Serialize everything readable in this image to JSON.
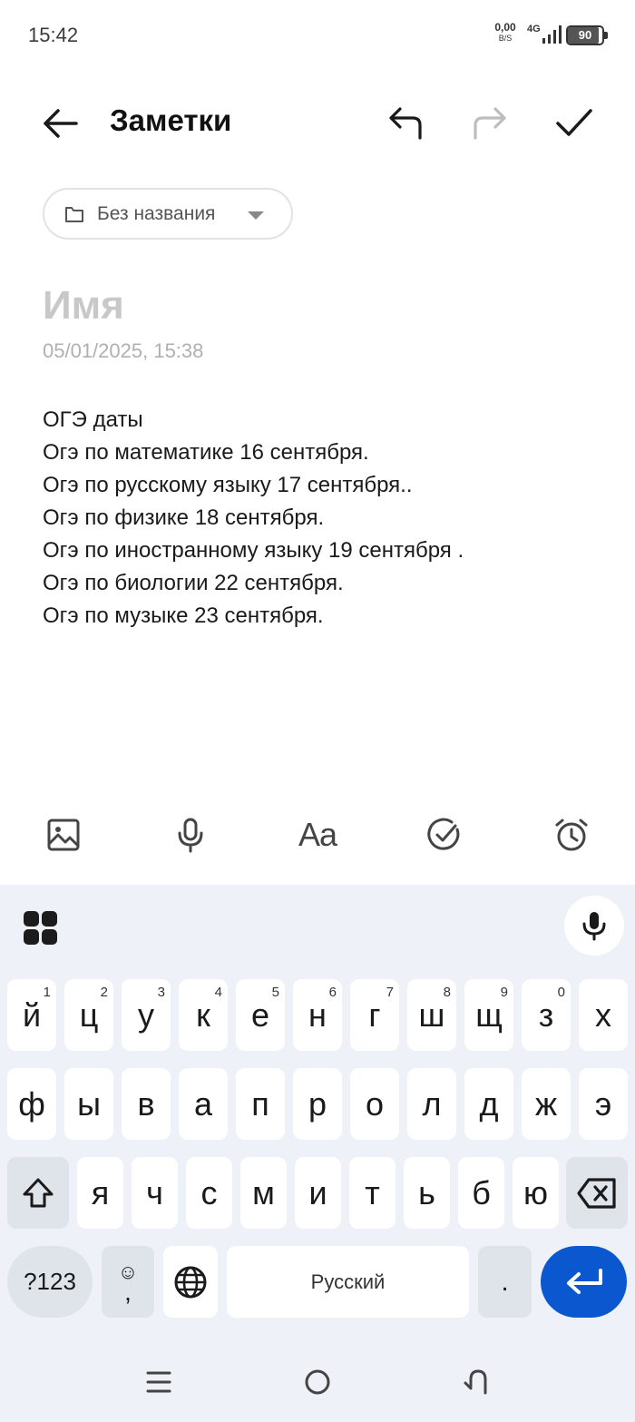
{
  "status_bar": {
    "time": "15:42",
    "net_speed_value": "0,00",
    "net_speed_unit": "B/S",
    "network_type": "4G",
    "battery_level": "90"
  },
  "header": {
    "title": "Заметки",
    "back_icon": "arrow-left-icon",
    "undo_icon": "undo-icon",
    "redo_icon": "redo-icon",
    "confirm_icon": "checkmark-icon"
  },
  "folder": {
    "label": "Без названия",
    "icon": "folder-icon"
  },
  "note": {
    "title_placeholder": "Имя",
    "timestamp": "05/01/2025, 15:38",
    "lines": [
      "ОГЭ даты",
      "Огэ по математике 16 сентября.",
      "Огэ по русскому языку 17 сентября..",
      "Огэ по физике 18 сентября.",
      "Огэ по иностранному языку 19 сентября .",
      "Огэ по биологии 22 сентября.",
      "Огэ по музыке 23 сентября."
    ]
  },
  "toolbar": {
    "image_icon": "image-icon",
    "mic_icon": "microphone-icon",
    "text_format_label": "Aa",
    "checklist_icon": "check-circle-icon",
    "reminder_icon": "alarm-clock-icon"
  },
  "keyboard": {
    "row1": [
      {
        "key": "й",
        "hint": "1"
      },
      {
        "key": "ц",
        "hint": "2"
      },
      {
        "key": "у",
        "hint": "3"
      },
      {
        "key": "к",
        "hint": "4"
      },
      {
        "key": "е",
        "hint": "5"
      },
      {
        "key": "н",
        "hint": "6"
      },
      {
        "key": "г",
        "hint": "7"
      },
      {
        "key": "ш",
        "hint": "8"
      },
      {
        "key": "щ",
        "hint": "9"
      },
      {
        "key": "з",
        "hint": "0"
      },
      {
        "key": "х",
        "hint": ""
      }
    ],
    "row2": [
      "ф",
      "ы",
      "в",
      "а",
      "п",
      "р",
      "о",
      "л",
      "д",
      "ж",
      "э"
    ],
    "row3": [
      "я",
      "ч",
      "с",
      "м",
      "и",
      "т",
      "ь",
      "б",
      "ю"
    ],
    "symbols_label": "?123",
    "emoji_label": "☺",
    "comma_label": ",",
    "space_label": "Русский",
    "period_label": ".",
    "shift_icon": "shift-icon",
    "backspace_icon": "backspace-icon",
    "globe_icon": "globe-icon",
    "enter_icon": "enter-icon",
    "apps_icon": "apps-grid-icon",
    "voice_icon": "microphone-icon"
  },
  "colors": {
    "keyboard_bg": "#eef2f8",
    "enter_key": "#0b57d0",
    "placeholder_text": "#c8c8c8"
  }
}
